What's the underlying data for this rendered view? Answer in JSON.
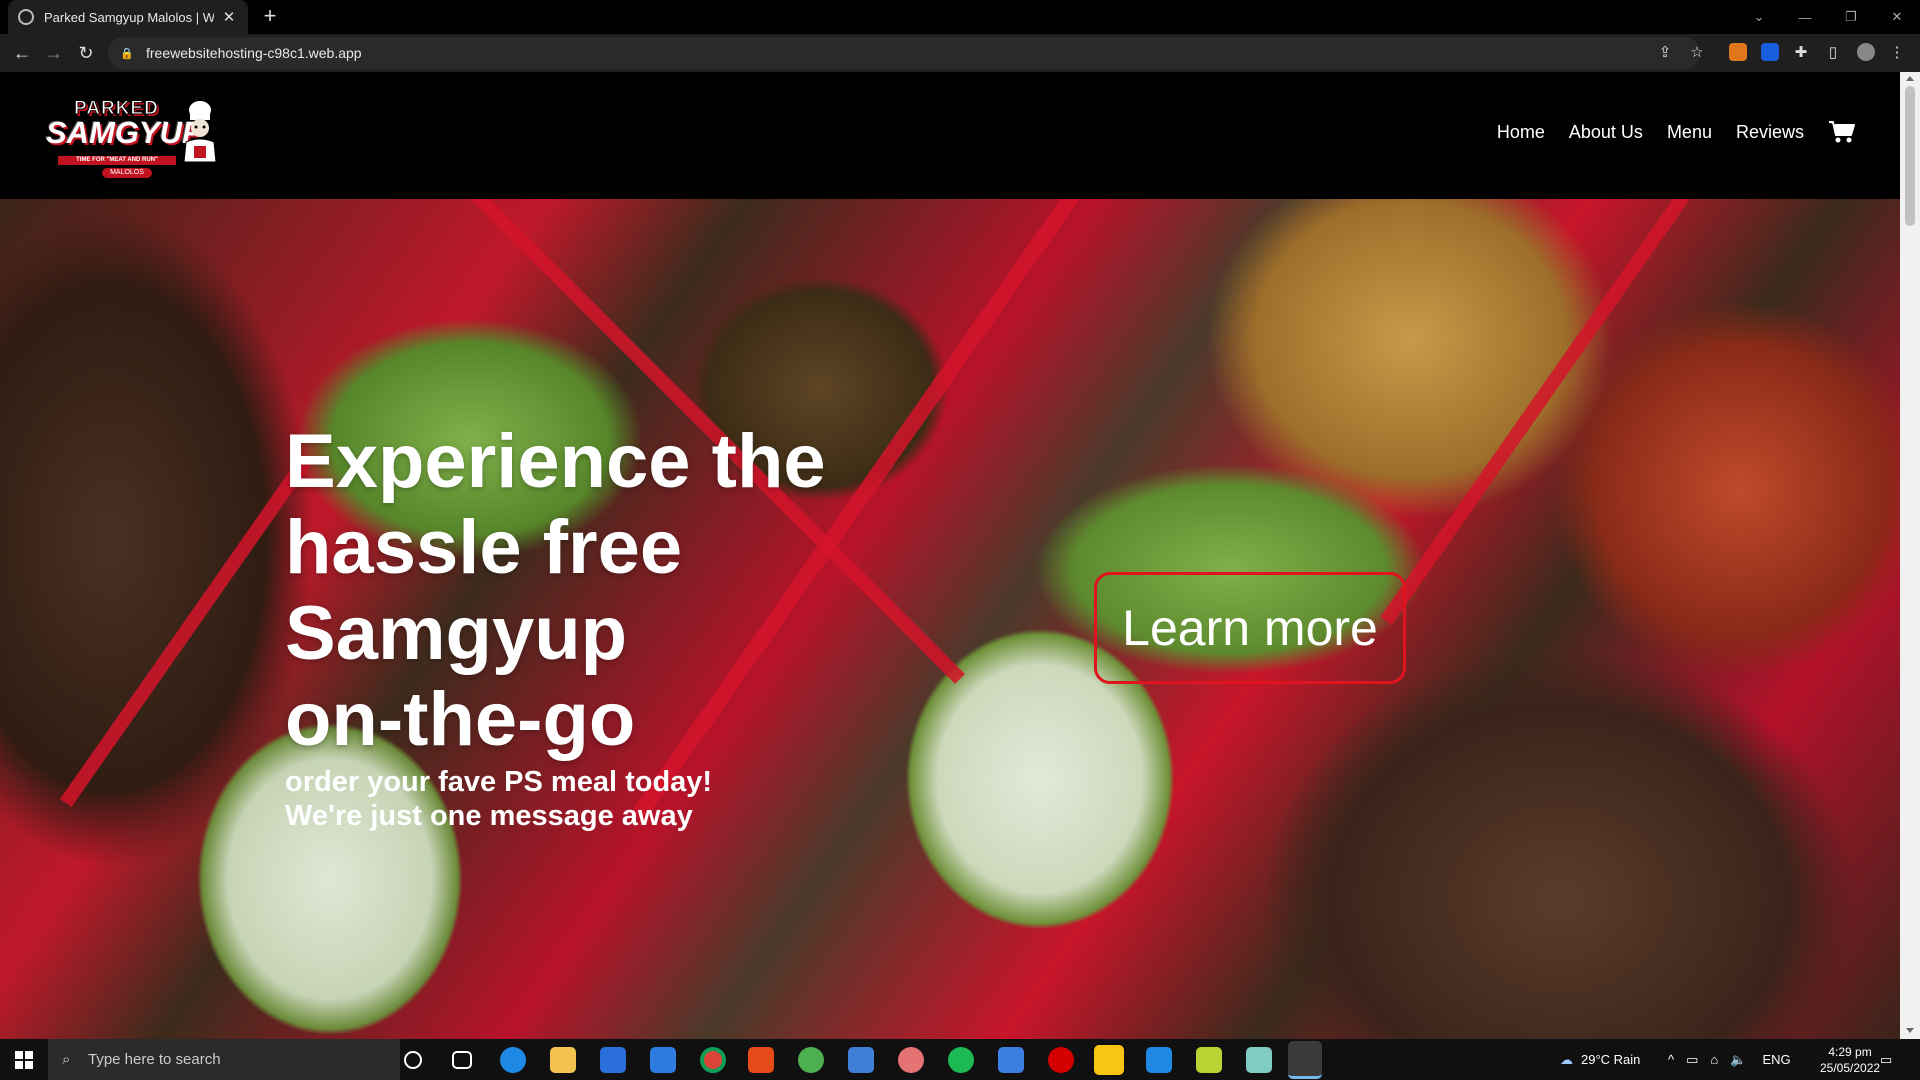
{
  "browser": {
    "tab_title": "Parked Samgyup Malolos | Webs",
    "url": "freewebsitehosting-c98c1.web.app"
  },
  "site": {
    "logo": {
      "line1": "PARKED",
      "line2": "SAMGYUP",
      "tagline": "TIME FOR \"MEAT AND RUN\"",
      "city": "MALOLOS"
    },
    "nav": [
      "Home",
      "About Us",
      "Menu",
      "Reviews"
    ],
    "hero": {
      "headline_lines": [
        "Experience the",
        "hassle free",
        "Samgyup",
        "on-the-go"
      ],
      "subline_lines": [
        "order your fave PS meal today!",
        "We're just one message away"
      ],
      "cta": "Learn more"
    }
  },
  "taskbar": {
    "search_placeholder": "Type here to search",
    "weather": "29°C  Rain",
    "language": "ENG",
    "time": "4:29 pm",
    "date": "25/05/2022"
  },
  "colors": {
    "accent_red": "#e0141e",
    "header_bg": "#000000"
  }
}
